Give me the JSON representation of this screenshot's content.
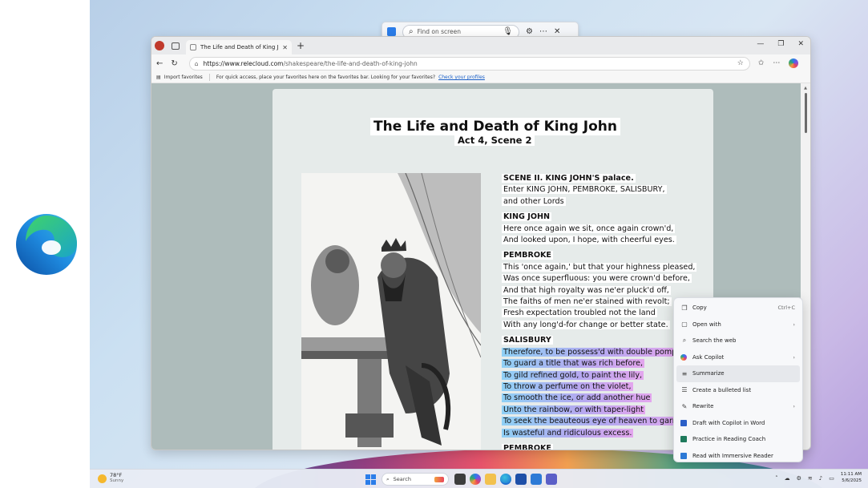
{
  "find_bar": {
    "placeholder": "Find on screen"
  },
  "browser": {
    "tab_title": "The Life and Death of King John",
    "url_host": "https://www.relecloud.com",
    "url_path": "/shakespeare/the-life-and-death-of-king-john",
    "favorites": {
      "import_label": "Import favorites",
      "hint_text": "For quick access, place your favorites here on the favorites bar. Looking for your favorites?",
      "hint_link": "Check your profiles"
    }
  },
  "page": {
    "title": "The Life and Death of King John",
    "subtitle": "Act 4, Scene 2",
    "script": {
      "scene": [
        "SCENE II. KING JOHN'S palace.",
        "Enter KING JOHN, PEMBROKE, SALISBURY,",
        "and other Lords"
      ],
      "king_john_speaker": "KING JOHN",
      "king_john_lines": [
        "Here once again we sit, once again crown'd,",
        "And looked upon, I hope, with cheerful eyes."
      ],
      "pembroke_speaker": "PEMBROKE",
      "pembroke_lines": [
        "This 'once again,' but that your highness pleased,",
        "Was once superfluous: you were crown'd before,",
        "And that high royalty was ne'er pluck'd off,",
        "The faiths of men ne'er stained with revolt;",
        "Fresh expectation troubled not the land",
        "With any long'd-for change or better state."
      ],
      "salisbury_speaker": "SALISBURY",
      "salisbury_lines": [
        "Therefore, to be possess'd with double pomp,",
        "To guard a title that was rich before,",
        "To gild refined gold, to paint the lily,",
        "To throw a perfume on the violet,",
        "To smooth the ice, or add another hue",
        "Unto the rainbow, or with taper-light",
        "To seek the beauteous eye of heaven to garnish,",
        "Is wasteful and ridiculous excess."
      ],
      "next_speaker": "PEMBROKE"
    }
  },
  "context_menu": {
    "items": [
      {
        "label": "Copy",
        "shortcut": "Ctrl+C"
      },
      {
        "label": "Open with"
      },
      {
        "label": "Search the web"
      },
      {
        "label": "Ask Copilot"
      },
      {
        "label": "Summarize"
      },
      {
        "label": "Create a bulleted list"
      },
      {
        "label": "Rewrite"
      },
      {
        "label": "Draft with Copilot in Word"
      },
      {
        "label": "Practice in Reading Coach"
      },
      {
        "label": "Read with Immersive Reader"
      }
    ]
  },
  "taskbar": {
    "weather_temp": "78°F",
    "weather_cond": "Sunny",
    "search_label": "Search",
    "time": "11:11 AM",
    "date": "5/6/2025"
  },
  "colors": {
    "highlight_start": "#8fd0f5",
    "highlight_end": "#e3a6ee",
    "edge_blue": "#1f6fd1",
    "edge_green": "#4cc36b"
  }
}
